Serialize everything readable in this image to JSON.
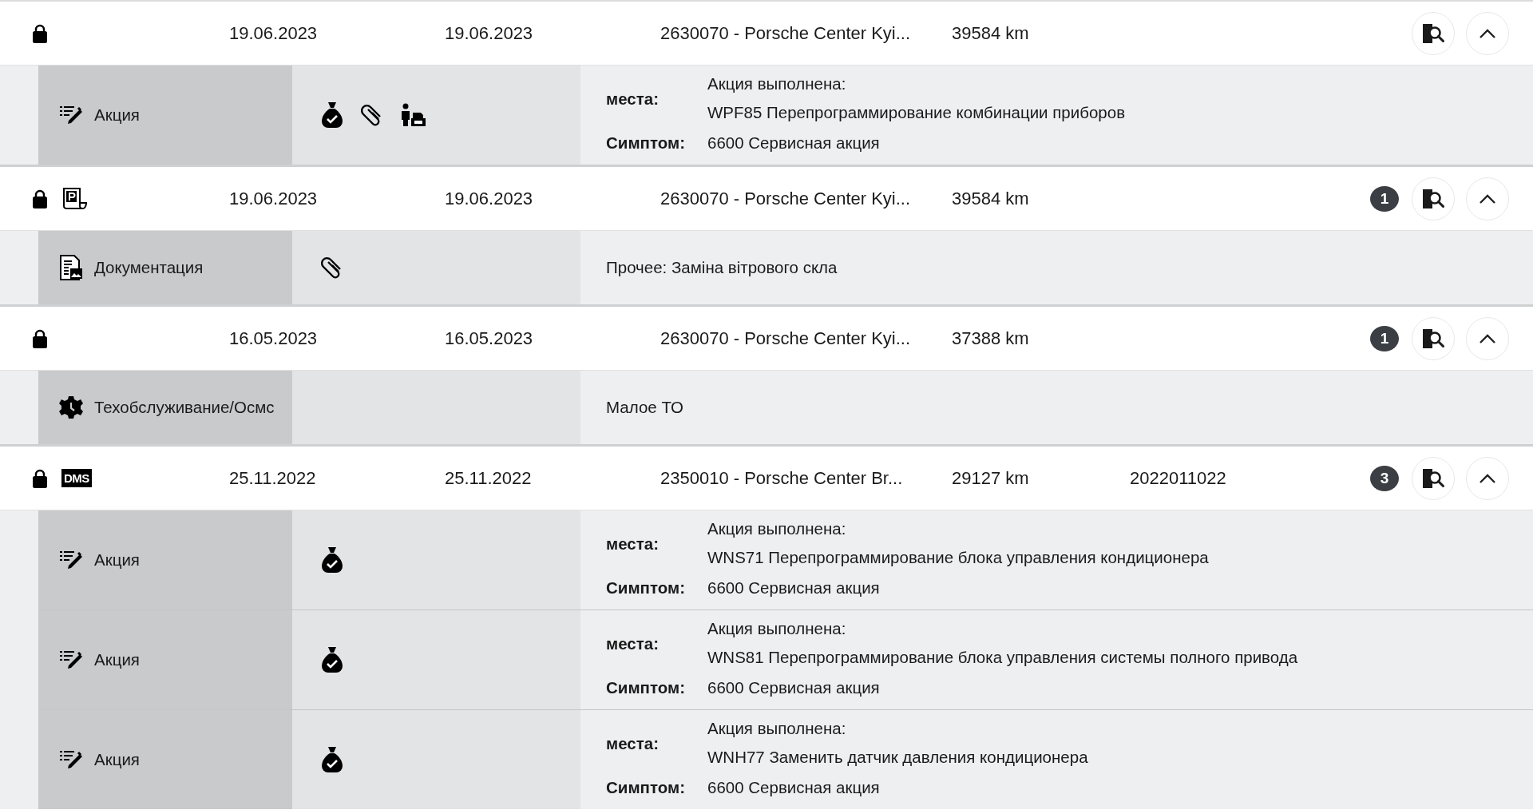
{
  "records": [
    {
      "locked": true,
      "date_start": "19.06.2023",
      "date_end": "19.06.2023",
      "dealer": "2630070 - Porsche Center Kyi...",
      "mileage": "39584 km",
      "expanded": true,
      "details": [
        {
          "icon": {
            "kind": "action"
          },
          "label": "Акция",
          "attachments": [
            {
              "kind": "money-bag"
            },
            {
              "kind": "paperclip"
            },
            {
              "kind": "person-print"
            }
          ],
          "kind": "action",
          "place_label": "места:",
          "status": "Акция выполнена:",
          "work": "WPF85 Перепрограммирование комбинации приборов",
          "symptom_label": "Симптом:",
          "symptom": "6600 Сервисная акция"
        }
      ]
    },
    {
      "locked": true,
      "doc_icon": {
        "kind": "parking-doc"
      },
      "date_start": "19.06.2023",
      "date_end": "19.06.2023",
      "dealer": "2630070 - Porsche Center Kyi...",
      "mileage": "39584 km",
      "badge": "1",
      "expanded": true,
      "details": [
        {
          "icon": {
            "kind": "docs"
          },
          "label": "Документация",
          "attachments": [
            {
              "kind": "paperclip"
            }
          ],
          "kind": "note",
          "text": "Прочее: Заміна вітрового скла"
        }
      ]
    },
    {
      "locked": true,
      "date_start": "16.05.2023",
      "date_end": "16.05.2023",
      "dealer": "2630070 - Porsche Center Kyi...",
      "mileage": "37388 km",
      "badge": "1",
      "expanded": true,
      "details": [
        {
          "icon": {
            "kind": "service"
          },
          "label": "Техобслуживание/Осмс",
          "kind": "note",
          "text": "Малое ТО"
        }
      ]
    },
    {
      "locked": true,
      "doc_icon": {
        "kind": "dms",
        "text": "DMS"
      },
      "date_start": "25.11.2022",
      "date_end": "25.11.2022",
      "dealer": "2350010 - Porsche Center Br...",
      "mileage": "29127 km",
      "order": "2022011022",
      "badge": "3",
      "expanded": true,
      "details": [
        {
          "icon": {
            "kind": "action"
          },
          "label": "Акция",
          "attachments": [
            {
              "kind": "money-bag"
            }
          ],
          "kind": "action",
          "place_label": "места:",
          "status": "Акция выполнена:",
          "work": "WNS71 Перепрограммирование блока управления кондиционера",
          "symptom_label": "Симптом:",
          "symptom": "6600 Сервисная акция"
        },
        {
          "icon": {
            "kind": "action"
          },
          "label": "Акция",
          "attachments": [
            {
              "kind": "money-bag"
            }
          ],
          "kind": "action",
          "place_label": "места:",
          "status": "Акция выполнена:",
          "work": "WNS81 Перепрограммирование блока управления системы полного привода",
          "symptom_label": "Симптом:",
          "symptom": "6600 Сервисная акция"
        },
        {
          "icon": {
            "kind": "action"
          },
          "label": "Акция",
          "attachments": [
            {
              "kind": "money-bag"
            }
          ],
          "kind": "action",
          "place_label": "места:",
          "status": "Акция выполнена:",
          "work": "WNH77 Заменить датчик давления кондиционера",
          "symptom_label": "Симптом:",
          "symptom": "6600 Сервисная акция"
        }
      ]
    }
  ]
}
